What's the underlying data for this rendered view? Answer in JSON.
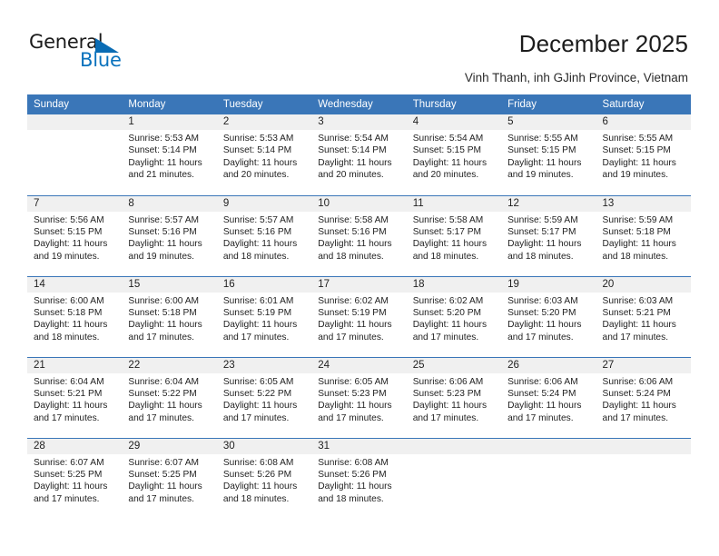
{
  "logo": {
    "word1": "General",
    "word2": "Blue",
    "triangle_color": "#0a6cb4",
    "blue_text_color": "#0a72bd"
  },
  "header": {
    "title": "December 2025",
    "subtitle": "Vinh Thanh, inh GJinh Province, Vietnam"
  },
  "theme": {
    "header_blue": "#3a76b8",
    "daynum_gray": "#f0f0f0",
    "text": "#1f1f1f"
  },
  "weekday_headers": [
    "Sunday",
    "Monday",
    "Tuesday",
    "Wednesday",
    "Thursday",
    "Friday",
    "Saturday"
  ],
  "weeks": [
    [
      {
        "day": "",
        "empty": true,
        "sunrise": "",
        "sunset": "",
        "daylight": ""
      },
      {
        "day": "1",
        "sunrise": "Sunrise: 5:53 AM",
        "sunset": "Sunset: 5:14 PM",
        "daylight": "Daylight: 11 hours and 21 minutes."
      },
      {
        "day": "2",
        "sunrise": "Sunrise: 5:53 AM",
        "sunset": "Sunset: 5:14 PM",
        "daylight": "Daylight: 11 hours and 20 minutes."
      },
      {
        "day": "3",
        "sunrise": "Sunrise: 5:54 AM",
        "sunset": "Sunset: 5:14 PM",
        "daylight": "Daylight: 11 hours and 20 minutes."
      },
      {
        "day": "4",
        "sunrise": "Sunrise: 5:54 AM",
        "sunset": "Sunset: 5:15 PM",
        "daylight": "Daylight: 11 hours and 20 minutes."
      },
      {
        "day": "5",
        "sunrise": "Sunrise: 5:55 AM",
        "sunset": "Sunset: 5:15 PM",
        "daylight": "Daylight: 11 hours and 19 minutes."
      },
      {
        "day": "6",
        "sunrise": "Sunrise: 5:55 AM",
        "sunset": "Sunset: 5:15 PM",
        "daylight": "Daylight: 11 hours and 19 minutes."
      }
    ],
    [
      {
        "day": "7",
        "sunrise": "Sunrise: 5:56 AM",
        "sunset": "Sunset: 5:15 PM",
        "daylight": "Daylight: 11 hours and 19 minutes."
      },
      {
        "day": "8",
        "sunrise": "Sunrise: 5:57 AM",
        "sunset": "Sunset: 5:16 PM",
        "daylight": "Daylight: 11 hours and 19 minutes."
      },
      {
        "day": "9",
        "sunrise": "Sunrise: 5:57 AM",
        "sunset": "Sunset: 5:16 PM",
        "daylight": "Daylight: 11 hours and 18 minutes."
      },
      {
        "day": "10",
        "sunrise": "Sunrise: 5:58 AM",
        "sunset": "Sunset: 5:16 PM",
        "daylight": "Daylight: 11 hours and 18 minutes."
      },
      {
        "day": "11",
        "sunrise": "Sunrise: 5:58 AM",
        "sunset": "Sunset: 5:17 PM",
        "daylight": "Daylight: 11 hours and 18 minutes."
      },
      {
        "day": "12",
        "sunrise": "Sunrise: 5:59 AM",
        "sunset": "Sunset: 5:17 PM",
        "daylight": "Daylight: 11 hours and 18 minutes."
      },
      {
        "day": "13",
        "sunrise": "Sunrise: 5:59 AM",
        "sunset": "Sunset: 5:18 PM",
        "daylight": "Daylight: 11 hours and 18 minutes."
      }
    ],
    [
      {
        "day": "14",
        "sunrise": "Sunrise: 6:00 AM",
        "sunset": "Sunset: 5:18 PM",
        "daylight": "Daylight: 11 hours and 18 minutes."
      },
      {
        "day": "15",
        "sunrise": "Sunrise: 6:00 AM",
        "sunset": "Sunset: 5:18 PM",
        "daylight": "Daylight: 11 hours and 17 minutes."
      },
      {
        "day": "16",
        "sunrise": "Sunrise: 6:01 AM",
        "sunset": "Sunset: 5:19 PM",
        "daylight": "Daylight: 11 hours and 17 minutes."
      },
      {
        "day": "17",
        "sunrise": "Sunrise: 6:02 AM",
        "sunset": "Sunset: 5:19 PM",
        "daylight": "Daylight: 11 hours and 17 minutes."
      },
      {
        "day": "18",
        "sunrise": "Sunrise: 6:02 AM",
        "sunset": "Sunset: 5:20 PM",
        "daylight": "Daylight: 11 hours and 17 minutes."
      },
      {
        "day": "19",
        "sunrise": "Sunrise: 6:03 AM",
        "sunset": "Sunset: 5:20 PM",
        "daylight": "Daylight: 11 hours and 17 minutes."
      },
      {
        "day": "20",
        "sunrise": "Sunrise: 6:03 AM",
        "sunset": "Sunset: 5:21 PM",
        "daylight": "Daylight: 11 hours and 17 minutes."
      }
    ],
    [
      {
        "day": "21",
        "sunrise": "Sunrise: 6:04 AM",
        "sunset": "Sunset: 5:21 PM",
        "daylight": "Daylight: 11 hours and 17 minutes."
      },
      {
        "day": "22",
        "sunrise": "Sunrise: 6:04 AM",
        "sunset": "Sunset: 5:22 PM",
        "daylight": "Daylight: 11 hours and 17 minutes."
      },
      {
        "day": "23",
        "sunrise": "Sunrise: 6:05 AM",
        "sunset": "Sunset: 5:22 PM",
        "daylight": "Daylight: 11 hours and 17 minutes."
      },
      {
        "day": "24",
        "sunrise": "Sunrise: 6:05 AM",
        "sunset": "Sunset: 5:23 PM",
        "daylight": "Daylight: 11 hours and 17 minutes."
      },
      {
        "day": "25",
        "sunrise": "Sunrise: 6:06 AM",
        "sunset": "Sunset: 5:23 PM",
        "daylight": "Daylight: 11 hours and 17 minutes."
      },
      {
        "day": "26",
        "sunrise": "Sunrise: 6:06 AM",
        "sunset": "Sunset: 5:24 PM",
        "daylight": "Daylight: 11 hours and 17 minutes."
      },
      {
        "day": "27",
        "sunrise": "Sunrise: 6:06 AM",
        "sunset": "Sunset: 5:24 PM",
        "daylight": "Daylight: 11 hours and 17 minutes."
      }
    ],
    [
      {
        "day": "28",
        "sunrise": "Sunrise: 6:07 AM",
        "sunset": "Sunset: 5:25 PM",
        "daylight": "Daylight: 11 hours and 17 minutes."
      },
      {
        "day": "29",
        "sunrise": "Sunrise: 6:07 AM",
        "sunset": "Sunset: 5:25 PM",
        "daylight": "Daylight: 11 hours and 17 minutes."
      },
      {
        "day": "30",
        "sunrise": "Sunrise: 6:08 AM",
        "sunset": "Sunset: 5:26 PM",
        "daylight": "Daylight: 11 hours and 18 minutes."
      },
      {
        "day": "31",
        "sunrise": "Sunrise: 6:08 AM",
        "sunset": "Sunset: 5:26 PM",
        "daylight": "Daylight: 11 hours and 18 minutes."
      },
      {
        "day": "",
        "empty": true,
        "sunrise": "",
        "sunset": "",
        "daylight": ""
      },
      {
        "day": "",
        "empty": true,
        "sunrise": "",
        "sunset": "",
        "daylight": ""
      },
      {
        "day": "",
        "empty": true,
        "sunrise": "",
        "sunset": "",
        "daylight": ""
      }
    ]
  ]
}
